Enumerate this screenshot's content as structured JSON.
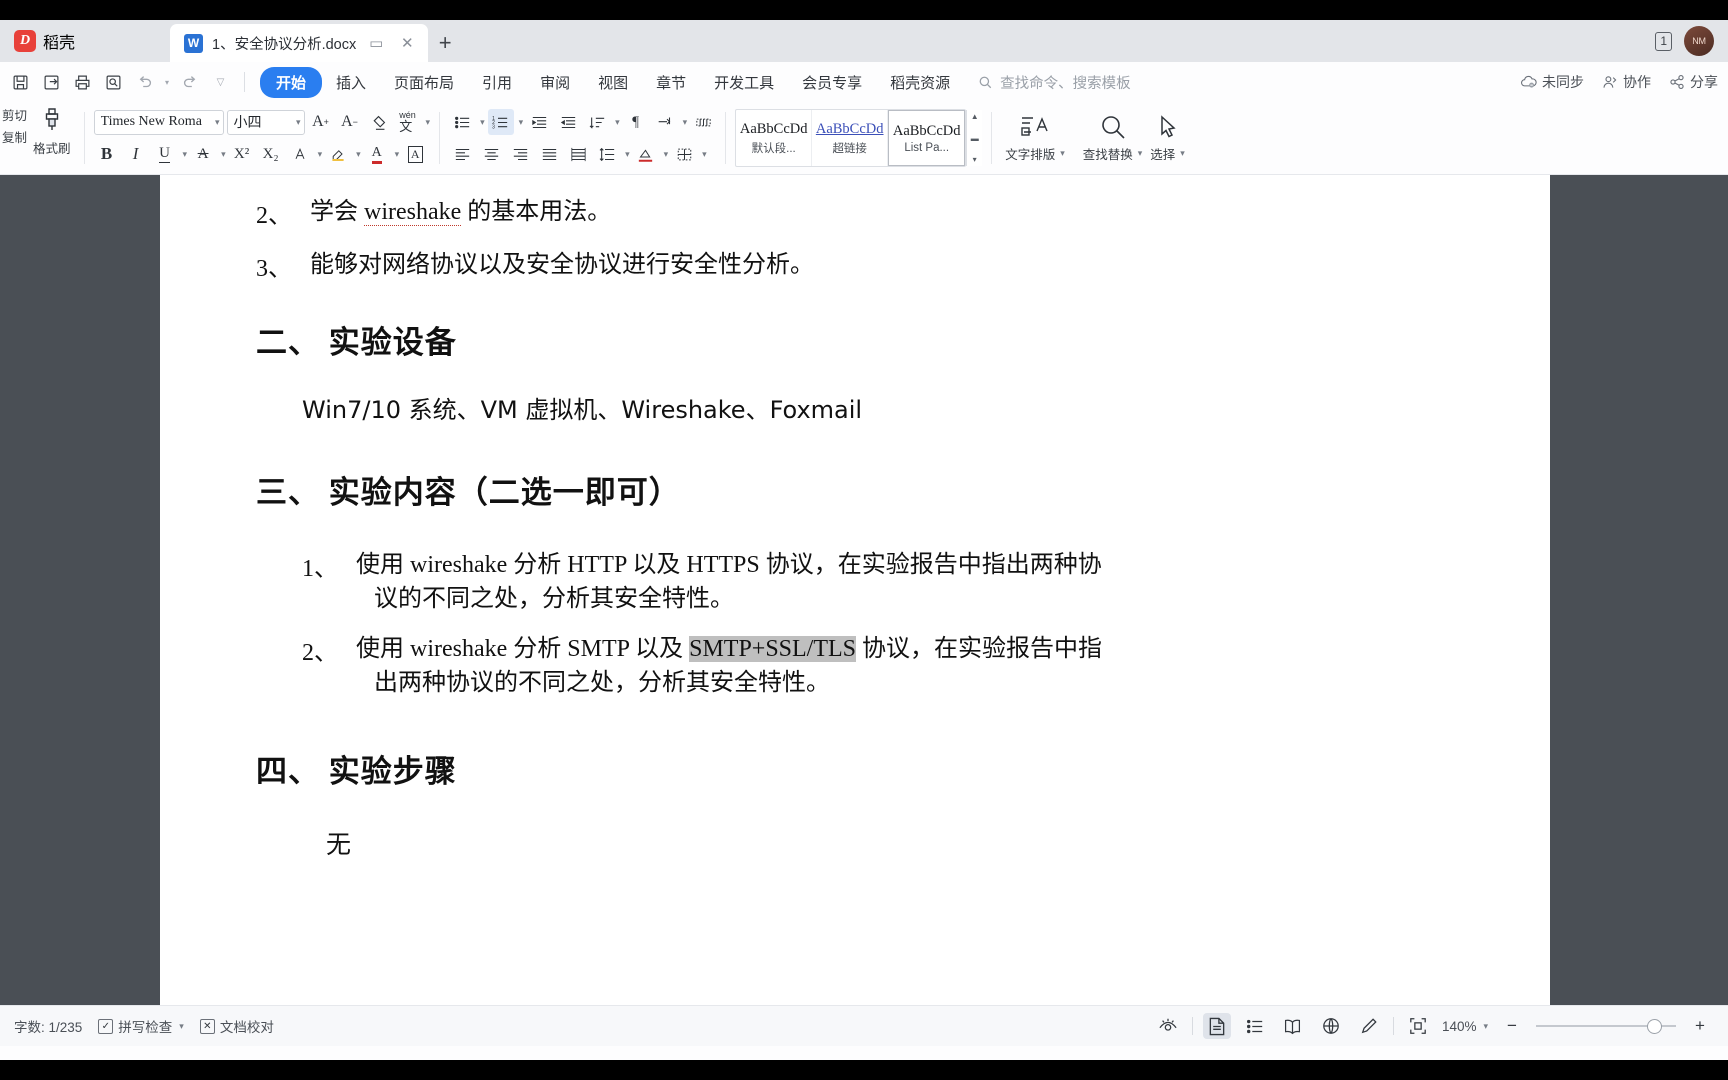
{
  "titlebar": {
    "brand": "稻壳",
    "brand_mark": "D",
    "tab_name": "1、安全协议分析.docx",
    "tab_icon_letter": "W",
    "restore_icon": "▭",
    "close_icon": "✕",
    "new_tab_icon": "+",
    "window_count": "1",
    "avatar_text": "NM"
  },
  "ribbon_tabs": {
    "quick_access": [
      {
        "name": "save-icon",
        "glyph": "🖫"
      },
      {
        "name": "save-as-icon",
        "glyph": "⎙"
      },
      {
        "name": "print-icon",
        "glyph": "🖨"
      },
      {
        "name": "print-preview-icon",
        "glyph": "🔍"
      },
      {
        "name": "undo-icon",
        "glyph": "↺"
      },
      {
        "name": "redo-icon",
        "glyph": "↻"
      },
      {
        "name": "customize-icon",
        "glyph": "▿"
      }
    ],
    "tabs": [
      {
        "label": "开始",
        "active": true
      },
      {
        "label": "插入",
        "active": false
      },
      {
        "label": "页面布局",
        "active": false
      },
      {
        "label": "引用",
        "active": false
      },
      {
        "label": "审阅",
        "active": false
      },
      {
        "label": "视图",
        "active": false
      },
      {
        "label": "章节",
        "active": false
      },
      {
        "label": "开发工具",
        "active": false
      },
      {
        "label": "会员专享",
        "active": false
      },
      {
        "label": "稻壳资源",
        "active": false
      }
    ],
    "search_placeholder": "查找命令、搜索模板",
    "right_items": [
      {
        "label": "未同步",
        "icon": "cloud-sync-icon"
      },
      {
        "label": "协作",
        "icon": "collaborate-icon"
      },
      {
        "label": "分享",
        "icon": "share-icon"
      }
    ]
  },
  "ribbon": {
    "clipboard": {
      "cut": "剪切",
      "copy": "复制",
      "format_painter": "格式刷"
    },
    "font": {
      "family": "Times New Roma",
      "size": "小四",
      "grow_icon": "A⁺",
      "shrink_icon": "A⁻",
      "clear_format_icon": "◇",
      "pinyin_icon": "文",
      "bold": "B",
      "italic": "I",
      "underline": "U",
      "strikethrough": "A",
      "superscript": "X²",
      "subscript": "X₂",
      "text_effect": "A",
      "highlight": "◇",
      "font_color": "A",
      "char_border": "A"
    },
    "paragraph": {
      "bullets_icon": "⋮≡",
      "numbering_icon": "1≡",
      "decrease_indent_icon": "⇤",
      "increase_indent_icon": "⇥",
      "sort_icon": "↓≡",
      "show_marks_icon": "¶",
      "line_spacing_icon": "↕≡",
      "align_left_icon": "≡",
      "align_center_icon": "≡",
      "align_right_icon": "≡",
      "justify_icon": "≡",
      "distribute_icon": "≡",
      "shading_icon": "◇",
      "borders_icon": "⊞"
    },
    "styles": [
      {
        "preview": "AaBbCcDd",
        "name": "默认段...",
        "link": false,
        "selected": false
      },
      {
        "preview": "AaBbCcDd",
        "name": "超链接",
        "link": true,
        "selected": false
      },
      {
        "preview": "AaBbCcDd",
        "name": "List Pa...",
        "link": false,
        "selected": true
      }
    ],
    "typeset_label": "文字排版",
    "find_replace_label": "查找替换",
    "select_label": "选择"
  },
  "document": {
    "list_top": [
      {
        "num": "2、",
        "parts": [
          {
            "t": "学会 ",
            "sq": false
          },
          {
            "t": "wireshake",
            "sq": true
          },
          {
            "t": " 的基本用法。",
            "sq": false
          }
        ]
      },
      {
        "num": "3、",
        "parts": [
          {
            "t": "能够对网络协议以及安全协议进行安全性分析。",
            "sq": false
          }
        ]
      }
    ],
    "h_equipment": "二、 实验设备",
    "equipment_text": "Win7/10 系统、VM 虚拟机、Wireshake、Foxmail",
    "h_content": "三、 实验内容（二选一即可）",
    "content_items": [
      {
        "num": "1、",
        "line1": "使用 wireshake 分析 HTTP 以及 HTTPS 协议，在实验报告中指出两种协",
        "line2": "议的不同之处，分析其安全特性。"
      },
      {
        "num": "2、",
        "line1_a": "使用 wireshake 分析 SMTP 以及 ",
        "line1_hl": "SMTP+SSL/TLS",
        "line1_b": " 协议，在实验报告中指",
        "line2": "出两种协议的不同之处，分析其安全特性。"
      }
    ],
    "h_steps": "四、 实验步骤",
    "steps_text": "无"
  },
  "statusbar": {
    "word_count": "字数: 1/235",
    "spellcheck": "拼写检查",
    "proofread": "文档校对",
    "eye_icon": "👁",
    "view_print_icon": "page-layout-view-icon",
    "view_outline_icon": "outline-view-icon",
    "view_read_icon": "read-mode-icon",
    "view_web_icon": "web-layout-icon",
    "view_pen_icon": "edit-pen-icon",
    "fit_icon": "fit-page-icon",
    "zoom": "140%",
    "zoom_out": "−",
    "zoom_in": "+"
  },
  "colors": {
    "accent": "#2a7ef0",
    "brand_red": "#e8413a",
    "doc_bg": "#4a4f55",
    "highlight": "#bfbfbf"
  }
}
